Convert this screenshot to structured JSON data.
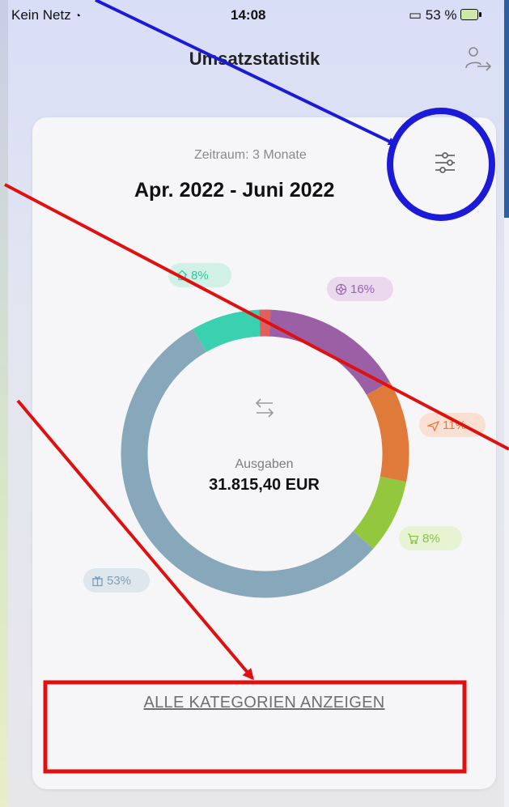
{
  "status_bar": {
    "carrier": "Kein Netz",
    "time": "14:08",
    "battery": "53 %"
  },
  "header": {
    "title": "Umsatzstatistik"
  },
  "card": {
    "period_label": "Zeitraum: 3 Monate",
    "period_range": "Apr. 2022 - Juni 2022",
    "center_label": "Ausgaben",
    "center_amount": "31.815,40 EUR",
    "show_all_label": "ALLE KATEGORIEN ANZEIGEN"
  },
  "chart_data": {
    "type": "pie",
    "title": "",
    "series": [
      {
        "icon": "home-icon",
        "percent": 8,
        "label": "8%",
        "color": "#3ad1b0"
      },
      {
        "icon": "entertainment-icon",
        "percent": 16,
        "label": "16%",
        "color": "#9b5fa6"
      },
      {
        "icon": "travel-icon",
        "percent": 11,
        "label": "11%",
        "color": "#e07a3a"
      },
      {
        "icon": "cart-icon",
        "percent": 8,
        "label": "8%",
        "color": "#93c83e"
      },
      {
        "icon": "gift-icon",
        "percent": 53,
        "label": "53%",
        "color": "#87a7bb"
      }
    ],
    "small_segment_color": "#e06060"
  },
  "annotation_colors": {
    "blue": "#1a1ad8",
    "red": "#e01010"
  }
}
